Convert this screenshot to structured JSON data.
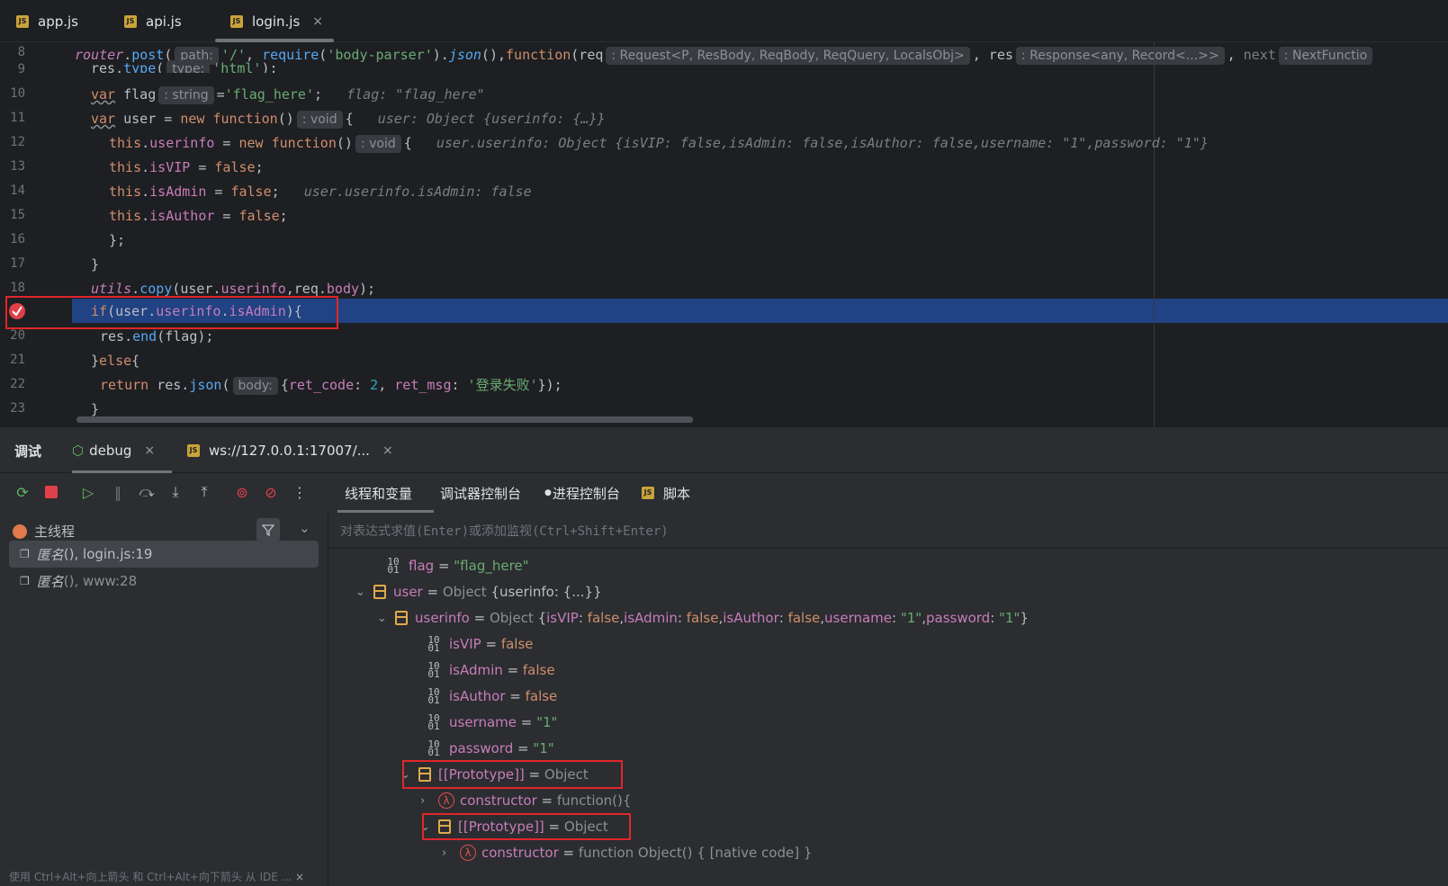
{
  "tabs": [
    {
      "label": "app.js"
    },
    {
      "label": "api.js"
    },
    {
      "label": "login.js",
      "close": "×"
    }
  ],
  "badge": "JS",
  "editor": {
    "line_numbers": [
      "8",
      "9",
      "10",
      "11",
      "12",
      "13",
      "14",
      "15",
      "16",
      "17",
      "18",
      "",
      "20",
      "21",
      "22",
      "23"
    ],
    "hints": {
      "path": "path:",
      "req_type": ": Request<P, ResBody, ReqBody, ReqQuery, LocalsObj>",
      "res_type": ": Response<any, Record<...>>",
      "next_type": ": NextFunctio",
      "type": "type:",
      "string": ": string",
      "void1": ": void",
      "void2": ": void",
      "body": "body:"
    },
    "inline": {
      "flag": "flag: \"flag_here\"",
      "user": "user: Object {userinfo: {…}}",
      "userinfo": "user.userinfo: Object {isVIP: false,isAdmin: false,isAuthor: false,username: \"1\",password: \"1\"}",
      "isadmin": "user.userinfo.isAdmin: false"
    }
  },
  "debug": {
    "tabs": [
      {
        "label": "调试"
      },
      {
        "label": "debug",
        "close": "×"
      },
      {
        "label": "ws://127.0.0.1:17007/...",
        "close": "×"
      }
    ],
    "var_tabs": [
      "线程和变量",
      "调试器控制台",
      "进程控制台",
      "脚本"
    ],
    "thread": "主线程",
    "frames": [
      {
        "name": "匿名",
        "loc": "(), login.js:19"
      },
      {
        "name": "匿名",
        "loc": "(), www:28"
      }
    ],
    "search_placeholder": "对表达式求值(Enter)或添加监视(Ctrl+Shift+Enter)",
    "footer": "使用 Ctrl+Alt+向上箭头 和 Ctrl+Alt+向下箭头 从 IDE ...",
    "footer_close": "×"
  },
  "vars": {
    "flag_name": "flag",
    "flag_val": "\"flag_here\"",
    "user_name": "user",
    "user_type": "Object",
    "user_summary": "{userinfo: {...}}",
    "ui_name": "userinfo",
    "ui_type": "Object",
    "isvip_name": "isVIP",
    "isadmin_name": "isAdmin",
    "isauthor_name": "isAuthor",
    "false": "false",
    "username_name": "username",
    "password_name": "password",
    "one": "\"1\"",
    "proto": "[[Prototype]]",
    "obj": "Object",
    "ctor": "constructor",
    "ctor_val1": "function(){",
    "ctor_val2": "function Object() { [native code] }"
  }
}
